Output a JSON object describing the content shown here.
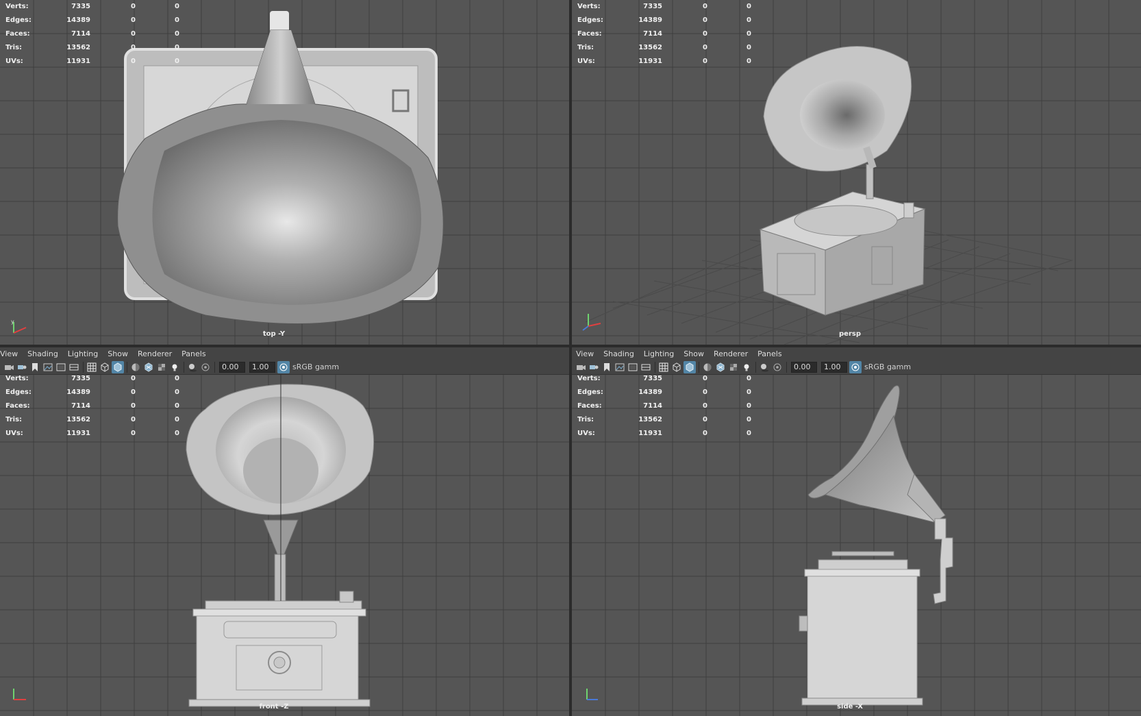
{
  "colors": {
    "viewport_bg": "#555555",
    "grid_line": "#3f3f3f",
    "panel_bg": "#444444",
    "accent": "#5285a6",
    "model_light": "#c9c9c9",
    "model_mid": "#9a9a9a",
    "model_dark": "#5e5e5e"
  },
  "hud": {
    "rows": [
      {
        "label": "Verts:",
        "v1": "7335",
        "v2": "0",
        "v3": "0"
      },
      {
        "label": "Edges:",
        "v1": "14389",
        "v2": "0",
        "v3": "0"
      },
      {
        "label": "Faces:",
        "v1": "7114",
        "v2": "0",
        "v3": "0"
      },
      {
        "label": "Tris:",
        "v1": "13562",
        "v2": "0",
        "v3": "0"
      },
      {
        "label": "UVs:",
        "v1": "11931",
        "v2": "0",
        "v3": "0"
      }
    ]
  },
  "viewports": {
    "top_left": {
      "camera": "top -Y"
    },
    "top_right": {
      "camera": "persp"
    },
    "bottom_left": {
      "camera": "front -Z"
    },
    "bottom_right": {
      "camera": "side -X"
    }
  },
  "menu": {
    "view": "View",
    "shading": "Shading",
    "lighting": "Lighting",
    "show": "Show",
    "renderer": "Renderer",
    "panels": "Panels"
  },
  "toolbar": {
    "exposure": "0.00",
    "gamma": "1.00",
    "color_space": "sRGB gamm",
    "icons": [
      "select-camera-icon",
      "camera-attributes-icon",
      "bookmark-icon",
      "image-plane-icon",
      "film-gate-icon",
      "resolution-gate-icon",
      "grid-toggle-icon",
      "wireframe-icon",
      "smooth-shade-icon",
      "default-material-icon",
      "xray-icon",
      "textured-icon",
      "lighting-icon",
      "shadows-icon",
      "isolate-select-icon"
    ]
  }
}
